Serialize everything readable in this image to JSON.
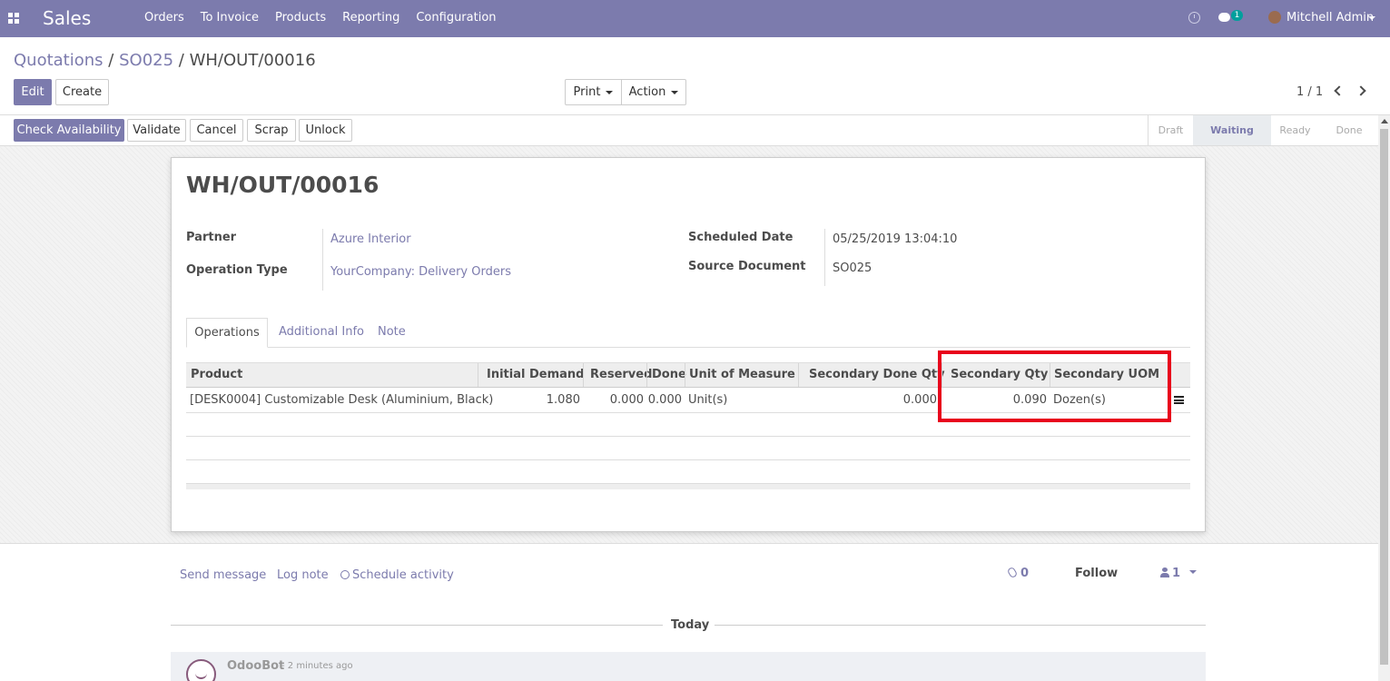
{
  "navbar": {
    "app_name": "Sales",
    "menu": [
      "Orders",
      "To Invoice",
      "Products",
      "Reporting",
      "Configuration"
    ],
    "chat_badge": "1",
    "user": "Mitchell Admin",
    "color": "#7c7bad"
  },
  "breadcrumb": {
    "items": [
      "Quotations",
      "SO025"
    ],
    "sep": "/",
    "current": "WH/OUT/00016"
  },
  "buttons": {
    "edit": "Edit",
    "create": "Create",
    "print": "Print",
    "action": "Action",
    "check_availability": "Check Availability",
    "validate": "Validate",
    "cancel": "Cancel",
    "scrap": "Scrap",
    "unlock": "Unlock"
  },
  "pager": "1 / 1",
  "stages": [
    "Draft",
    "Waiting",
    "Ready",
    "Done"
  ],
  "active_stage": "Waiting",
  "record": {
    "title": "WH/OUT/00016",
    "fields": {
      "partner_label": "Partner",
      "partner_value": "Azure Interior",
      "operation_type_label": "Operation Type",
      "operation_type_value": "YourCompany: Delivery Orders",
      "scheduled_date_label": "Scheduled Date",
      "scheduled_date_value": "05/25/2019 13:04:10",
      "source_document_label": "Source Document",
      "source_document_value": "SO025"
    }
  },
  "tabs": [
    "Operations",
    "Additional Info",
    "Note"
  ],
  "table": {
    "headers": [
      "Product",
      "Initial Demand",
      "Reserved",
      "Done",
      "Unit of Measure",
      "Secondary Done Qty",
      "Secondary Qty",
      "Secondary UOM"
    ],
    "rows": [
      {
        "product": "[DESK0004] Customizable Desk (Aluminium, Black)",
        "initial_demand": "1.080",
        "reserved": "0.000",
        "done": "0.000",
        "uom": "Unit(s)",
        "secondary_done_qty": "0.000",
        "secondary_qty": "0.090",
        "secondary_uom": "Dozen(s)"
      }
    ]
  },
  "chatter": {
    "send_message": "Send message",
    "log_note": "Log note",
    "schedule_activity": "Schedule activity",
    "attachments": "0",
    "follow": "Follow",
    "followers": "1",
    "today": "Today",
    "author": "OdooBot",
    "time": "- 2 minutes ago"
  }
}
